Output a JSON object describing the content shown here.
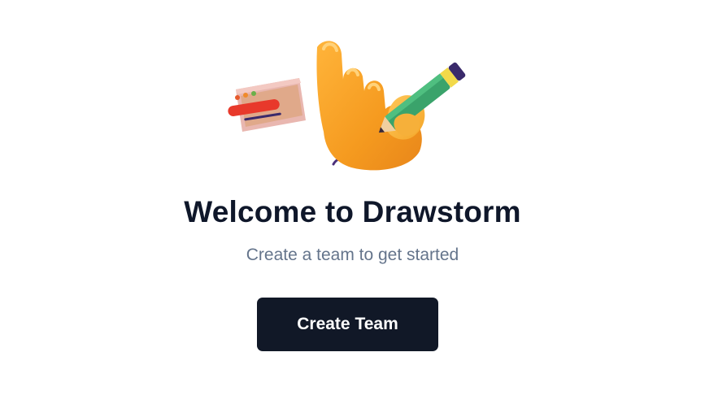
{
  "welcome": {
    "title": "Welcome to Drawstorm",
    "subtitle": "Create a team to get started",
    "create_button_label": "Create Team"
  },
  "illustration": {
    "icon": "hand-holding-pencil-icon",
    "secondary_icon": "drawing-card-icon"
  },
  "colors": {
    "title": "#0f172a",
    "subtitle": "#64748b",
    "button_bg": "#111827",
    "button_text": "#ffffff",
    "hand": "#f5a623",
    "pencil": "#3aa36b"
  }
}
